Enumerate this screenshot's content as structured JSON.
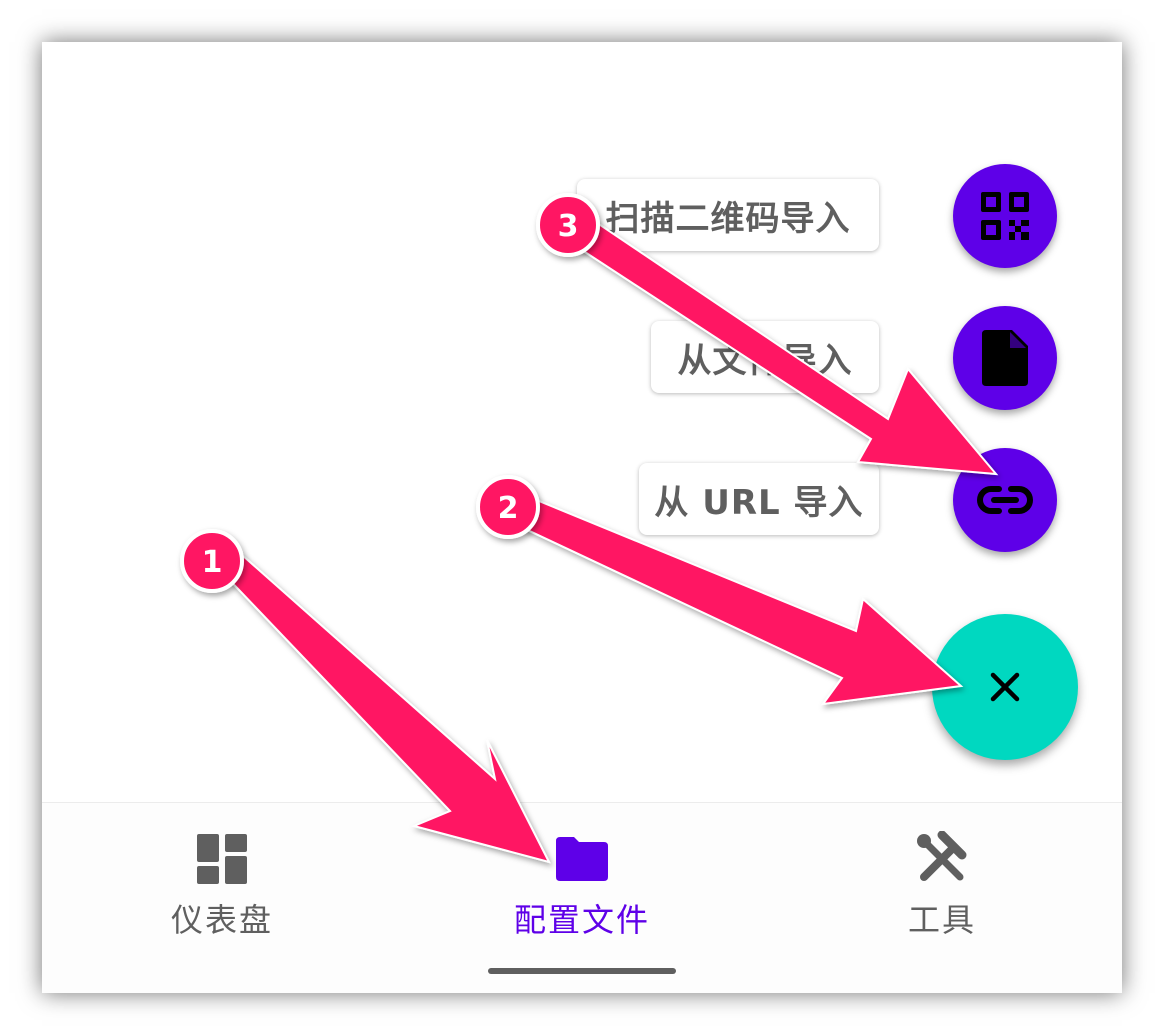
{
  "fab_menu": {
    "items": [
      {
        "label": "扫描二维码导入",
        "icon": "qr-code-icon"
      },
      {
        "label": "从文件导入",
        "icon": "file-icon"
      },
      {
        "label": "从 URL 导入",
        "icon": "link-icon"
      }
    ],
    "close_icon": "close-icon"
  },
  "bottom_nav": {
    "items": [
      {
        "label": "仪表盘",
        "icon": "dashboard-icon",
        "active": false
      },
      {
        "label": "配置文件",
        "icon": "folder-icon",
        "active": true
      },
      {
        "label": "工具",
        "icon": "tools-icon",
        "active": false
      }
    ]
  },
  "annotations": {
    "markers": [
      {
        "number": "1"
      },
      {
        "number": "2"
      },
      {
        "number": "3"
      }
    ]
  },
  "colors": {
    "accent": "#5e00e8",
    "fab_main": "#00d8c0",
    "annotation": "#ff1464",
    "label_text": "#5f5f5f"
  }
}
